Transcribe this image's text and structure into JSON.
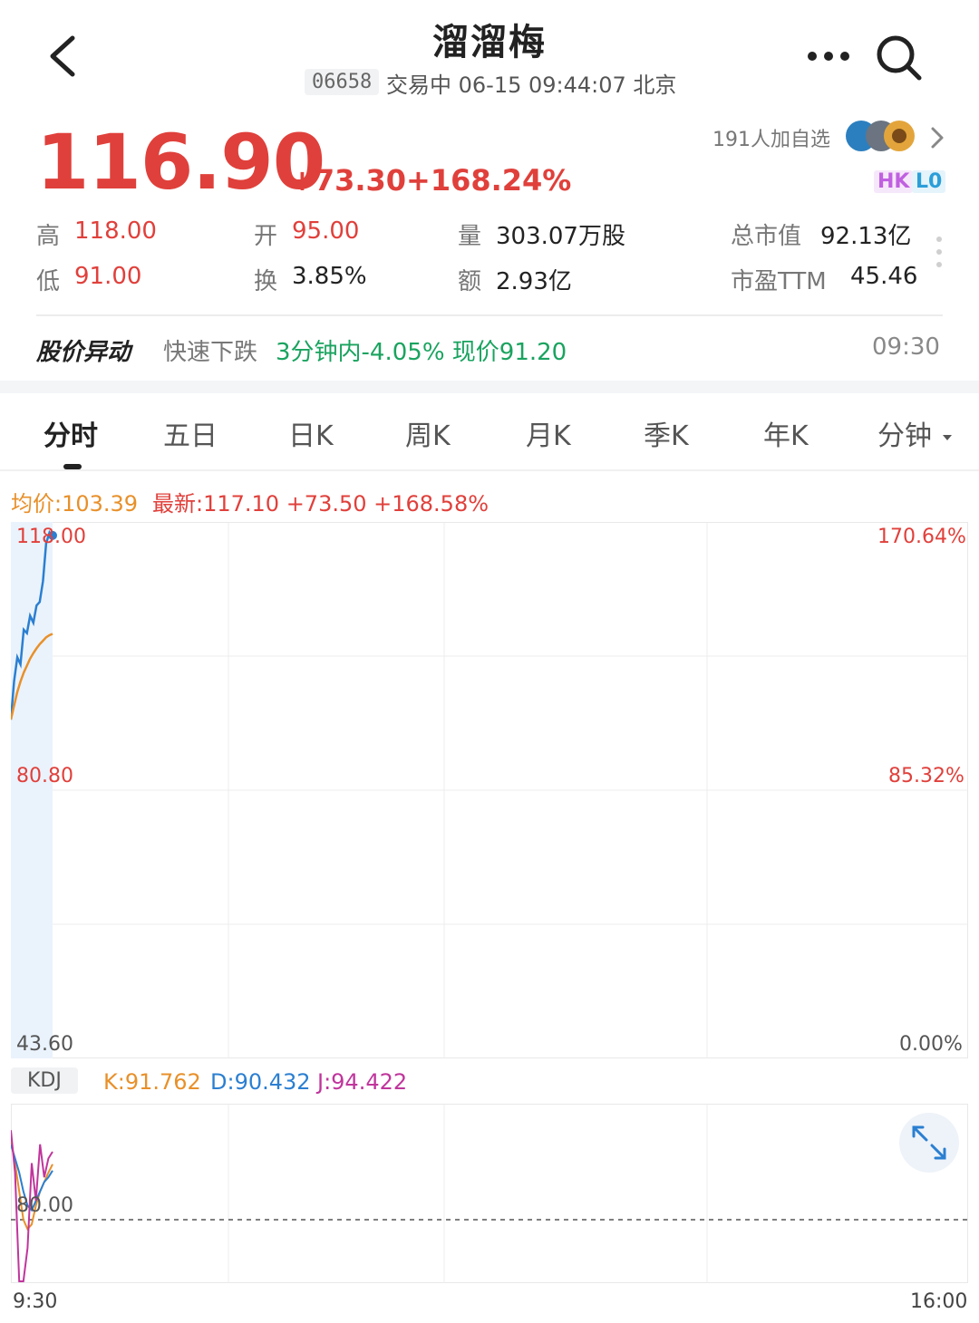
{
  "header": {
    "title": "溜溜梅",
    "code": "06658",
    "status": "交易中 06-15 09:44:07 北京"
  },
  "quote": {
    "price": "116.90",
    "change": "+73.30",
    "change_pct": "+168.24%",
    "followers": "191人加自选",
    "badge_hk": "HK",
    "badge_l0": "L0"
  },
  "stats": {
    "high_label": "高",
    "high": "118.00",
    "low_label": "低",
    "low": "91.00",
    "open_label": "开",
    "open": "95.00",
    "turnover_label": "换",
    "turnover": "3.85%",
    "volume_label": "量",
    "volume": "303.07万股",
    "amount_label": "额",
    "amount": "2.93亿",
    "mktcap_label": "总市值",
    "mktcap": "92.13亿",
    "pe_label": "市盈TTM",
    "pe": "45.46"
  },
  "alert": {
    "title": "股价异动",
    "type": "快速下跌",
    "detail": "3分钟内-4.05% 现价91.20",
    "time": "09:30"
  },
  "tabs": [
    "分时",
    "五日",
    "日K",
    "周K",
    "月K",
    "季K",
    "年K",
    "分钟"
  ],
  "chart_header": {
    "avg": "均价:103.39",
    "latest": "最新:117.10 +73.50 +168.58%"
  },
  "chart_axes": {
    "y_top": "118.00",
    "y_mid": "80.80",
    "y_bottom": "43.60",
    "pct_top": "170.64%",
    "pct_mid": "85.32%",
    "pct_bottom": "0.00%",
    "x_start": "9:30",
    "x_end": "16:00"
  },
  "kdj": {
    "label": "KDJ",
    "k": "K:91.762",
    "d": "D:90.432",
    "j": "J:94.422",
    "ref_level": "80.00"
  },
  "colors": {
    "up": "#e0403b",
    "down": "#1aa35f",
    "price_line": "#2b7fd1",
    "avg_line": "#e8902a",
    "j_line": "#c0359c"
  },
  "chart_data": {
    "type": "line",
    "x_range": [
      "9:30",
      "16:00"
    ],
    "ylim": [
      43.6,
      118.0
    ],
    "series": [
      {
        "name": "最新",
        "values": [
          91.0,
          96.5,
          100.0,
          99.0,
          104.0,
          103.5,
          106.0,
          105.0,
          107.5,
          108.0,
          111.0,
          116.5,
          118.0,
          117.1
        ]
      },
      {
        "name": "均价",
        "values": [
          91.0,
          93.0,
          95.0,
          96.5,
          97.8,
          98.8,
          99.8,
          100.6,
          101.3,
          101.9,
          102.4,
          102.9,
          103.2,
          103.39
        ]
      }
    ],
    "kdj": {
      "ref_level": 80,
      "k": [
        97,
        92,
        86,
        80,
        78,
        79,
        83,
        86,
        88,
        90,
        91.762
      ],
      "d": [
        96,
        93,
        90,
        86,
        83,
        82,
        84,
        86,
        88,
        89,
        90.432
      ],
      "j": [
        99,
        90,
        62,
        48,
        74,
        92,
        84,
        96,
        89,
        93,
        94.422
      ]
    }
  }
}
